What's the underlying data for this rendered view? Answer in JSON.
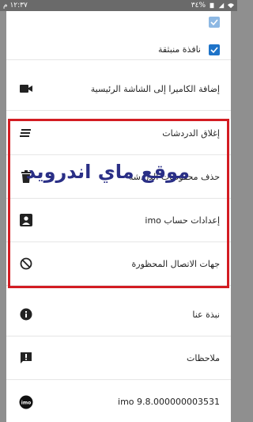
{
  "status_bar": {
    "time": "١٢:٣٧ م",
    "battery": "٣٤%"
  },
  "toolbar": {
    "back_icon": "arrow-left-icon"
  },
  "top_partial_item": {
    "label": "نافذة منبثقة",
    "checked": true,
    "accent": "#1e73c8"
  },
  "menu": [
    {
      "id": "add-camera",
      "label": "إضافة الكاميرا إلى الشاشة الرئيسية",
      "icon": "video-camera-icon"
    },
    {
      "id": "close-chats",
      "label": "إغلاق الدردشات",
      "icon": "lines-icon"
    },
    {
      "id": "delete-history",
      "label": "حذف محفوظات الدردشة",
      "icon": "trash-icon"
    },
    {
      "id": "account-settings",
      "label": "إعدادات حساب imo",
      "icon": "account-box-icon"
    },
    {
      "id": "blocked-contacts",
      "label": "جهات الاتصال المحظورة",
      "icon": "block-icon"
    },
    {
      "id": "about",
      "label": "نبذة عنا",
      "icon": "info-icon"
    },
    {
      "id": "feedback",
      "label": "ملاحظات",
      "icon": "feedback-icon"
    },
    {
      "id": "version",
      "label": "imo 9.8.000000003531",
      "icon": "imo-logo-icon"
    }
  ],
  "watermark": "موقع ماي اندرويد",
  "highlight_color": "#d31c22"
}
